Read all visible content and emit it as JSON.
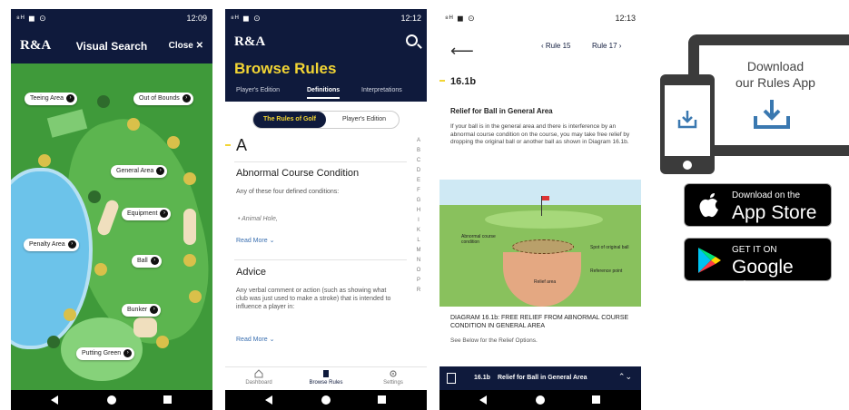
{
  "status_bar": {
    "signal": "⁸ᴴ ◼ ⊙",
    "wifi_battery": "▾◢ ▮",
    "times": [
      "12:09",
      "12:12",
      "12:13"
    ]
  },
  "screen1": {
    "logo": "R&A",
    "title": "Visual Search",
    "close": "Close ✕",
    "labels": [
      "Teeing Area",
      "Out of Bounds",
      "General Area",
      "Equipment",
      "Penalty Area",
      "Ball",
      "Bunker",
      "Putting Green"
    ]
  },
  "screen2": {
    "logo": "R&A",
    "title": "Browse Rules",
    "tabs": [
      "Player's Edition",
      "Definitions",
      "Interpretations"
    ],
    "active_tab": "Definitions",
    "toggle": [
      "The Rules of Golf",
      "Player's Edition"
    ],
    "letter": "A",
    "entries": [
      {
        "term": "Abnormal Course Condition",
        "definition": "Any of these four defined conditions:",
        "bullet": "• Animal Hole,",
        "more": "Read More ⌄"
      },
      {
        "term": "Advice",
        "definition": "Any verbal comment or action (such as showing what club was just used to make a stroke) that is intended to influence a player in:",
        "more": "Read More ⌄"
      }
    ],
    "alphabet": [
      "A",
      "B",
      "C",
      "D",
      "E",
      "F",
      "G",
      "H",
      "I",
      "K",
      "L",
      "M",
      "N",
      "O",
      "P",
      "R"
    ],
    "bottom_nav": [
      "Dashboard",
      "Browse Rules",
      "Settings"
    ]
  },
  "screen3": {
    "back": "⟵",
    "prev": "‹ Rule 15",
    "next": "Rule 17 ›",
    "rule_number": "16.1b",
    "heading": "Relief for Ball in General Area",
    "body": "If your ball is in the general area and there is interference by an abnormal course condition on the course, you may take free relief by dropping the original ball or another ball as shown in Diagram 16.1b.",
    "diagram_labels": [
      "Abnormal course condition",
      "Spot of original ball",
      "Reference point",
      "Relief area"
    ],
    "caption": "DIAGRAM 16.1b: FREE RELIEF FROM ABNORMAL COURSE CONDITION IN GENERAL AREA",
    "caption_sub": "See Below for the Relief Options.",
    "footer_number": "16.1b",
    "footer_title": "Relief for Ball in General Area",
    "footer_chevron": "⌃⌄"
  },
  "promo": {
    "line1": "Download",
    "line2": "our Rules App",
    "appstore_small": "Download on the",
    "appstore_big": "App Store",
    "googleplay_small": "GET IT ON",
    "googleplay_big": "Google play"
  },
  "colors": {
    "navy": "#0f1a3c",
    "yellow": "#f2d534",
    "grass": "#3f9a3a",
    "water": "#6cc3ea"
  }
}
